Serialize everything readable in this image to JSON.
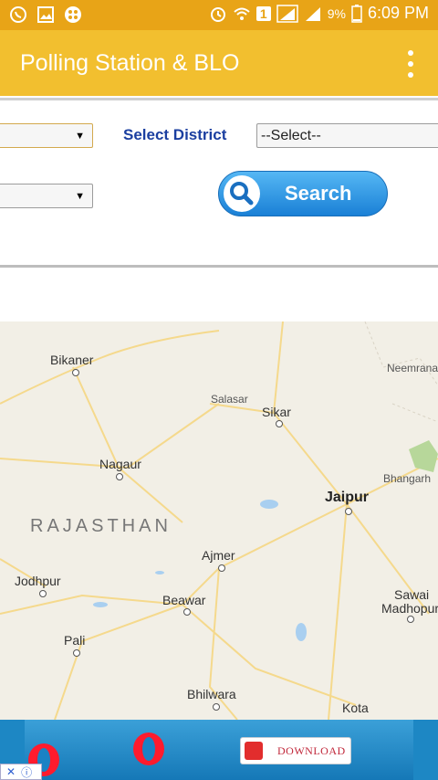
{
  "status_bar": {
    "battery_percent": "9%",
    "time": "6:09 PM",
    "sim_badge": "1",
    "left_icons": [
      "whatsapp-icon",
      "image-icon",
      "app-icon"
    ],
    "right_icons": [
      "alarm-icon",
      "wifi-icon",
      "signal-icon",
      "battery-icon"
    ]
  },
  "app_bar": {
    "title": "Polling Station & BLO",
    "menu_icon": "more-vert-icon"
  },
  "form": {
    "district_label": "Select District",
    "district_select_value": "--Select--",
    "search_button_label": "Search"
  },
  "map": {
    "region_label": "RAJASTHAN",
    "places": [
      {
        "name": "Bikaner"
      },
      {
        "name": "Salasar"
      },
      {
        "name": "Sikar"
      },
      {
        "name": "Neemrana"
      },
      {
        "name": "Nagaur"
      },
      {
        "name": "Bhangarh"
      },
      {
        "name": "Jaipur"
      },
      {
        "name": "Ajmer"
      },
      {
        "name": "Jodhpur"
      },
      {
        "name": "Beawar"
      },
      {
        "name": "Sawai"
      },
      {
        "name": "Madhopur"
      },
      {
        "name": "Pali"
      },
      {
        "name": "Bhilwara"
      },
      {
        "name": "Kota"
      }
    ]
  },
  "ad": {
    "download_label": "DOWNLOAD",
    "brand_icon": "opera-icon"
  },
  "colors": {
    "status_bar": "#e8a417",
    "app_bar": "#f2bf2f",
    "district_label": "#1b3fa0",
    "search_button": "#2a8fe0",
    "map_bg": "#f2efe6",
    "ad_bg": "#1d87c4"
  }
}
